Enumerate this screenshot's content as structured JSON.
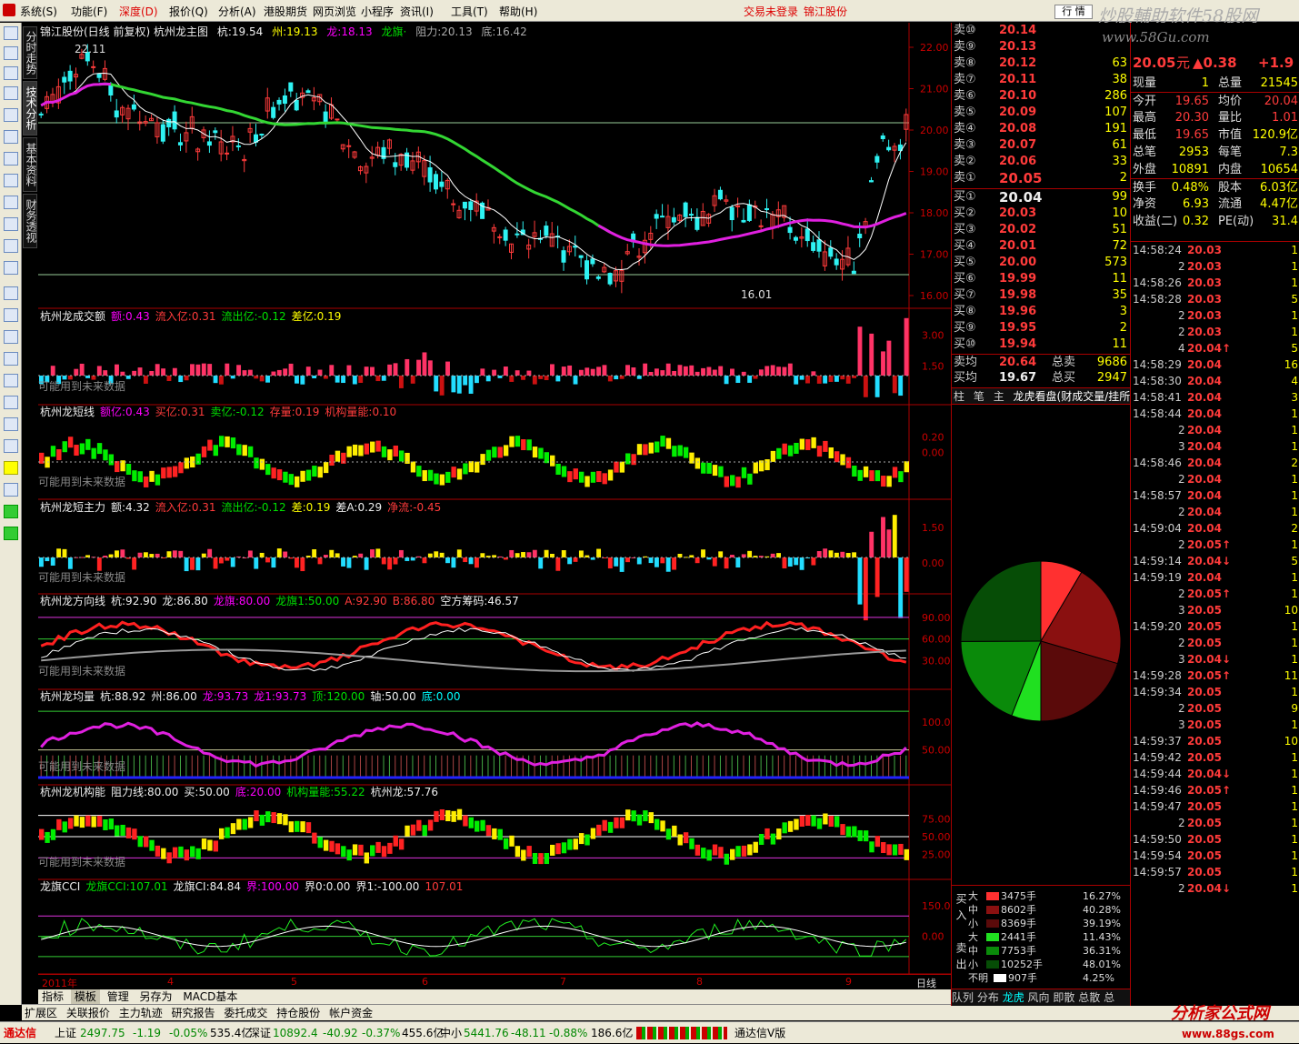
{
  "menu": {
    "items": [
      "系统(S)",
      "功能(F)",
      "深度(D)",
      "报价(Q)",
      "分析(A)",
      "港股期货",
      "网页浏览",
      "小程序",
      "资讯(I)",
      "工具(T)",
      "帮助(H)"
    ],
    "alert_login": "交易未登录",
    "alert_stock": "锦江股份",
    "tab_button": "行  情",
    "watermark": "炒股輔助软件58股网",
    "watermark_url": "www.58Gu.com"
  },
  "side_tabs": [
    "分时走势",
    "技术分析",
    "基本资料",
    "财务透视"
  ],
  "main_chart": {
    "title": "锦江股份(日线 前复权) 杭州龙主图",
    "hang": "杭:19.54",
    "zhou": "州:19.13",
    "long": "龙:18.13",
    "longzu": "龙旗·",
    "zuli": "阻力:20.13",
    "di": "底:16.42",
    "high_label": "22.11",
    "low_label": "16.01",
    "yticks": [
      "22.00",
      "21.00",
      "20.00",
      "19.00",
      "18.00",
      "17.00",
      "16.00"
    ]
  },
  "panels": [
    {
      "name": "杭州龙成交额",
      "items": [
        {
          "t": "额:0.43",
          "c": "mag"
        },
        {
          "t": "流入亿:0.31",
          "c": "red"
        },
        {
          "t": "流出亿:-0.12",
          "c": "grn"
        },
        {
          "t": "差亿:0.19",
          "c": "yel"
        }
      ],
      "note": "可能用到未来数据",
      "yticks": [
        "3.00",
        "1.50"
      ]
    },
    {
      "name": "杭州龙短线",
      "items": [
        {
          "t": "额亿:0.43",
          "c": "mag"
        },
        {
          "t": "买亿:0.31",
          "c": "red"
        },
        {
          "t": "卖亿:-0.12",
          "c": "grn"
        },
        {
          "t": "存量:0.19",
          "c": "red"
        },
        {
          "t": "机构量能:0.10",
          "c": "red"
        }
      ],
      "note": "可能用到未来数据",
      "yticks": [
        "0.20",
        "0.00"
      ]
    },
    {
      "name": "杭州龙短主力",
      "items": [
        {
          "t": "额:4.32",
          "c": "wht"
        },
        {
          "t": "流入亿:0.31",
          "c": "red"
        },
        {
          "t": "流出亿:-0.12",
          "c": "grn"
        },
        {
          "t": "差:0.19",
          "c": "yel"
        },
        {
          "t": "差A:0.29",
          "c": "wht"
        },
        {
          "t": "净流:-0.45",
          "c": "red"
        }
      ],
      "note": "可能用到未来数据",
      "yticks": [
        "1.50",
        "0.00"
      ]
    },
    {
      "name": "杭州龙方向线",
      "items": [
        {
          "t": "杭:92.90",
          "c": "wht"
        },
        {
          "t": "龙:86.80",
          "c": "wht"
        },
        {
          "t": "龙旗:80.00",
          "c": "mag"
        },
        {
          "t": "龙旗1:50.00",
          "c": "grn"
        },
        {
          "t": "A:92.90",
          "c": "red"
        },
        {
          "t": "B:86.80",
          "c": "red"
        },
        {
          "t": "空方筹码:46.57",
          "c": "wht"
        }
      ],
      "note": "可能用到未来数据",
      "yticks": [
        "90.00",
        "60.00",
        "30.00"
      ]
    },
    {
      "name": "杭州龙均量",
      "items": [
        {
          "t": "杭:88.92",
          "c": "wht"
        },
        {
          "t": "州:86.00",
          "c": "wht"
        },
        {
          "t": "龙:93.73",
          "c": "mag"
        },
        {
          "t": "龙1:93.73",
          "c": "mag"
        },
        {
          "t": "顶:120.00",
          "c": "grn"
        },
        {
          "t": "轴:50.00",
          "c": "wht"
        },
        {
          "t": "底:0.00",
          "c": "cyn"
        }
      ],
      "note": "可能用到未来数据",
      "yticks": [
        "100.0",
        "50.00"
      ]
    },
    {
      "name": "杭州龙机构能",
      "items": [
        {
          "t": "阻力线:80.00",
          "c": "wht"
        },
        {
          "t": "买:50.00",
          "c": "wht"
        },
        {
          "t": "底:20.00",
          "c": "mag"
        },
        {
          "t": "机构量能:55.22",
          "c": "grn"
        },
        {
          "t": "杭州龙:57.76",
          "c": "wht"
        }
      ],
      "note": "可能用到未来数据",
      "yticks": [
        "75.00",
        "50.00",
        "25.00"
      ]
    },
    {
      "name": "龙旗CCI",
      "items": [
        {
          "t": "龙旗CCI:107.01",
          "c": "grn"
        },
        {
          "t": "龙旗CI:84.84",
          "c": "wht"
        },
        {
          "t": "界:100.00",
          "c": "mag"
        },
        {
          "t": "界0:0.00",
          "c": "wht"
        },
        {
          "t": "界1:-100.00",
          "c": "wht"
        },
        {
          "t": "107.01",
          "c": "red"
        }
      ],
      "note": "",
      "yticks": [
        "150.0",
        "0.00"
      ]
    }
  ],
  "axis_labels": [
    "2011年",
    "4",
    "5",
    "6",
    "7",
    "8",
    "9"
  ],
  "axis_period": "日线",
  "bottom_tabs": [
    "指标",
    "模板",
    "管理",
    "另存为",
    "MACD基本"
  ],
  "bottom_tabs2": [
    "扩展区",
    "关联报价",
    "主力轨迹",
    "研究报告",
    "委托成交",
    "持仓股份",
    "帐户资金"
  ],
  "quote": {
    "sells": [
      {
        "l": "卖⑩",
        "p": "20.14",
        "v": ""
      },
      {
        "l": "卖⑨",
        "p": "20.13",
        "v": ""
      },
      {
        "l": "卖⑧",
        "p": "20.12",
        "v": "63"
      },
      {
        "l": "卖⑦",
        "p": "20.11",
        "v": "38"
      },
      {
        "l": "卖⑥",
        "p": "20.10",
        "v": "286"
      },
      {
        "l": "卖⑤",
        "p": "20.09",
        "v": "107"
      },
      {
        "l": "卖④",
        "p": "20.08",
        "v": "191"
      },
      {
        "l": "卖③",
        "p": "20.07",
        "v": "61"
      },
      {
        "l": "卖②",
        "p": "20.06",
        "v": "33"
      },
      {
        "l": "卖①",
        "p": "20.05",
        "v": "2"
      }
    ],
    "buys": [
      {
        "l": "买①",
        "p": "20.04",
        "v": "99"
      },
      {
        "l": "买②",
        "p": "20.03",
        "v": "10"
      },
      {
        "l": "买③",
        "p": "20.02",
        "v": "51"
      },
      {
        "l": "买④",
        "p": "20.01",
        "v": "72"
      },
      {
        "l": "买⑤",
        "p": "20.00",
        "v": "573"
      },
      {
        "l": "买⑥",
        "p": "19.99",
        "v": "11"
      },
      {
        "l": "买⑦",
        "p": "19.98",
        "v": "35"
      },
      {
        "l": "买⑧",
        "p": "19.96",
        "v": "3"
      },
      {
        "l": "买⑨",
        "p": "19.95",
        "v": "2"
      },
      {
        "l": "买⑩",
        "p": "19.94",
        "v": "11"
      }
    ],
    "avg_sell_label": "卖均",
    "avg_sell": "20.64",
    "total_sell_label": "总卖",
    "total_sell": "9686",
    "avg_buy_label": "买均",
    "avg_buy": "19.67",
    "total_buy_label": "总买",
    "total_buy": "2947",
    "tabs": [
      "柱",
      "笔",
      "主",
      "龙虎看盘(财成交量/挂所有"
    ],
    "pie": [
      {
        "value": 16.27,
        "color": "#ff3030"
      },
      {
        "value": 40.28,
        "color": "#8a1010"
      },
      {
        "value": 39.19,
        "color": "#5a0a0a"
      },
      {
        "value": 11.43,
        "color": "#20e020"
      },
      {
        "value": 36.31,
        "color": "#0a8a0a"
      },
      {
        "value": 48.01,
        "color": "#064d06"
      }
    ],
    "flow_in_label": "买入",
    "flow_out_label": "卖出",
    "flow": [
      {
        "k": "大",
        "v": "3475手",
        "pct": "16.27%",
        "c": "#ff3030"
      },
      {
        "k": "中",
        "v": "8602手",
        "pct": "40.28%",
        "c": "#8a1010"
      },
      {
        "k": "小",
        "v": "8369手",
        "pct": "39.19%",
        "c": "#5a0a0a"
      },
      {
        "k": "大",
        "v": "2441手",
        "pct": "11.43%",
        "c": "#20e020"
      },
      {
        "k": "中",
        "v": "7753手",
        "pct": "36.31%",
        "c": "#0a8a0a"
      },
      {
        "k": "小",
        "v": "10252手",
        "pct": "48.01%",
        "c": "#064d06"
      },
      {
        "k": "不明",
        "v": "907手",
        "pct": "4.25%",
        "c": "#ffffff"
      }
    ],
    "bottom": [
      "队列",
      "分布",
      "龙虎",
      "风向",
      "即散",
      "总散",
      "总"
    ]
  },
  "stats": {
    "price": "20.05",
    "unit": "元",
    "change": "▲0.38",
    "pct": "+1.9",
    "rows": [
      [
        "现量",
        "1",
        "总量",
        "21545"
      ],
      [
        "今开",
        "19.65",
        "均价",
        "20.04"
      ],
      [
        "最高",
        "20.30",
        "量比",
        "1.01"
      ],
      [
        "最低",
        "19.65",
        "市值",
        "120.9亿"
      ],
      [
        "总笔",
        "2953",
        "每笔",
        "7.3"
      ],
      [
        "外盘",
        "10891",
        "内盘",
        "10654"
      ],
      [
        "换手",
        "0.48%",
        "股本",
        "6.03亿"
      ],
      [
        "净资",
        "6.93",
        "流通",
        "4.47亿"
      ],
      [
        "收益(二)",
        "0.32",
        "PE(动)",
        "31.4"
      ]
    ]
  },
  "ticks": [
    {
      "t": "14:58:24",
      "p": "20.03",
      "v": "1",
      "c": "red"
    },
    {
      "t": "2",
      "p": "20.03",
      "v": "1",
      "c": "red"
    },
    {
      "t": "14:58:26",
      "p": "20.03",
      "v": "1",
      "c": "red"
    },
    {
      "t": "14:58:28",
      "p": "20.03",
      "v": "5",
      "c": "red"
    },
    {
      "t": "2",
      "p": "20.03",
      "v": "1",
      "c": "red"
    },
    {
      "t": "2",
      "p": "20.03",
      "v": "1",
      "c": "red"
    },
    {
      "t": "4",
      "p": "20.04↑",
      "v": "5",
      "c": "red"
    },
    {
      "t": "14:58:29",
      "p": "20.04",
      "v": "16",
      "c": "red"
    },
    {
      "t": "14:58:30",
      "p": "20.04",
      "v": "4",
      "c": "red"
    },
    {
      "t": "14:58:41",
      "p": "20.04",
      "v": "3",
      "c": "red"
    },
    {
      "t": "14:58:44",
      "p": "20.04",
      "v": "1",
      "c": "red"
    },
    {
      "t": "2",
      "p": "20.04",
      "v": "1",
      "c": "red"
    },
    {
      "t": "3",
      "p": "20.04",
      "v": "1",
      "c": "red"
    },
    {
      "t": "14:58:46",
      "p": "20.04",
      "v": "2",
      "c": "red"
    },
    {
      "t": "2",
      "p": "20.04",
      "v": "1",
      "c": "red"
    },
    {
      "t": "14:58:57",
      "p": "20.04",
      "v": "1",
      "c": "red"
    },
    {
      "t": "2",
      "p": "20.04",
      "v": "1",
      "c": "red"
    },
    {
      "t": "14:59:04",
      "p": "20.04",
      "v": "2",
      "c": "red"
    },
    {
      "t": "2",
      "p": "20.05↑",
      "v": "1",
      "c": "red"
    },
    {
      "t": "14:59:14",
      "p": "20.04↓",
      "v": "5",
      "c": "red"
    },
    {
      "t": "14:59:19",
      "p": "20.04",
      "v": "1",
      "c": "red"
    },
    {
      "t": "2",
      "p": "20.05↑",
      "v": "1",
      "c": "red"
    },
    {
      "t": "3",
      "p": "20.05",
      "v": "10",
      "c": "red"
    },
    {
      "t": "14:59:20",
      "p": "20.05",
      "v": "1",
      "c": "red"
    },
    {
      "t": "2",
      "p": "20.05",
      "v": "1",
      "c": "red"
    },
    {
      "t": "3",
      "p": "20.04↓",
      "v": "1",
      "c": "red"
    },
    {
      "t": "14:59:28",
      "p": "20.05↑",
      "v": "11",
      "c": "red"
    },
    {
      "t": "14:59:34",
      "p": "20.05",
      "v": "1",
      "c": "red"
    },
    {
      "t": "2",
      "p": "20.05",
      "v": "9",
      "c": "red"
    },
    {
      "t": "3",
      "p": "20.05",
      "v": "1",
      "c": "red"
    },
    {
      "t": "14:59:37",
      "p": "20.05",
      "v": "10",
      "c": "red"
    },
    {
      "t": "14:59:42",
      "p": "20.05",
      "v": "1",
      "c": "red"
    },
    {
      "t": "14:59:44",
      "p": "20.04↓",
      "v": "1",
      "c": "red"
    },
    {
      "t": "14:59:46",
      "p": "20.05↑",
      "v": "1",
      "c": "red"
    },
    {
      "t": "14:59:47",
      "p": "20.05",
      "v": "1",
      "c": "red"
    },
    {
      "t": "2",
      "p": "20.05",
      "v": "1",
      "c": "red"
    },
    {
      "t": "14:59:50",
      "p": "20.05",
      "v": "1",
      "c": "red"
    },
    {
      "t": "14:59:54",
      "p": "20.05",
      "v": "1",
      "c": "red"
    },
    {
      "t": "14:59:57",
      "p": "20.05",
      "v": "1",
      "c": "red"
    },
    {
      "t": "2",
      "p": "20.04↓",
      "v": "1",
      "c": "red"
    }
  ],
  "status": {
    "app": "通达信",
    "sh_label": "上证",
    "sh": "2497.75",
    "sh_chg": "-1.19",
    "sh_pct": "-0.05%",
    "sh_amt": "535.4亿",
    "sz_label": "深证",
    "sz": "10892.4",
    "sz_chg": "-40.92",
    "sz_pct": "-0.37%",
    "sz_amt": "455.6亿",
    "zx_label": "中小",
    "zx": "5441.76",
    "zx_chg": "-48.11",
    "zx_pct": "-0.88%",
    "zx_amt": "186.6亿",
    "version": "通达信V版",
    "logo_text": "分析家公式网",
    "logo_url": "www.88gs.com"
  }
}
